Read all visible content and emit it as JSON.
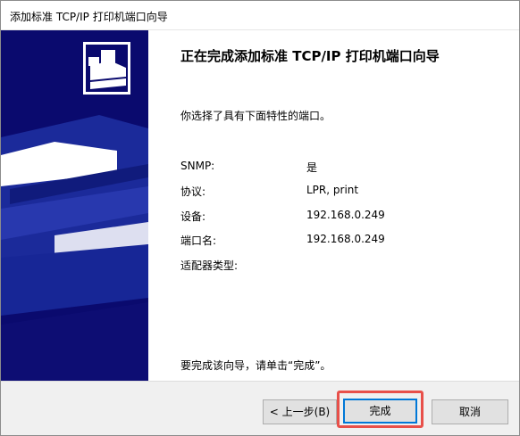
{
  "window": {
    "title": "添加标准 TCP/IP 打印机端口向导"
  },
  "side_panel": {
    "icon": "printer-icon",
    "accent_color": "#0a0a6e"
  },
  "main": {
    "heading": "正在完成添加标准 TCP/IP 打印机端口向导",
    "intro": "你选择了具有下面特性的端口。",
    "properties": [
      {
        "label": "SNMP:",
        "value": "是"
      },
      {
        "label": "协议:",
        "value": "LPR, print"
      },
      {
        "label": "设备:",
        "value": "192.168.0.249"
      },
      {
        "label": "端口名:",
        "value": "192.168.0.249"
      },
      {
        "label": "适配器类型:",
        "value": ""
      }
    ],
    "finish_note": "要完成该向导，请单击“完成”。"
  },
  "buttons": {
    "back_label": "< 上一步(B)",
    "finish_label": "完成",
    "cancel_label": "取消"
  },
  "colors": {
    "highlight": "#e8504a",
    "focus_border": "#0078d7"
  }
}
